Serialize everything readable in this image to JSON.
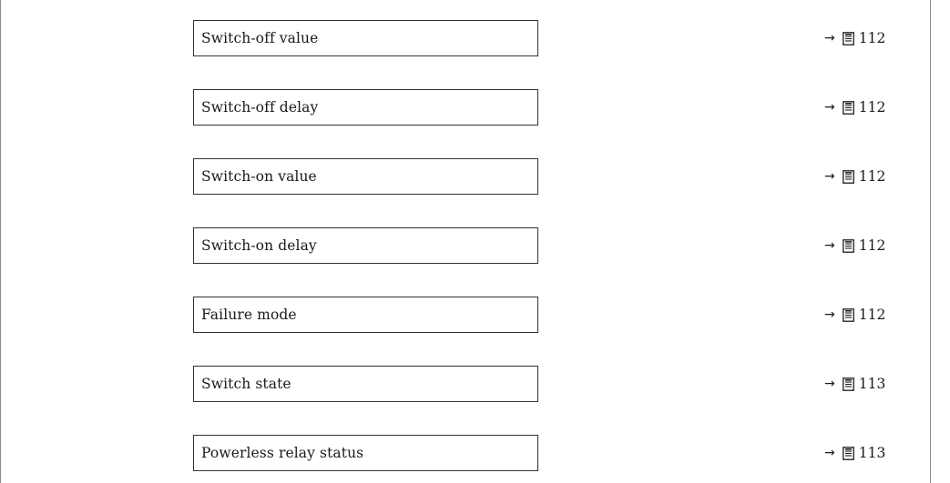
{
  "rows": [
    {
      "label": "Switch-off value",
      "arrow": "→",
      "page": "112"
    },
    {
      "label": "Switch-off delay",
      "arrow": "→",
      "page": "112"
    },
    {
      "label": "Switch-on value",
      "arrow": "→",
      "page": "112"
    },
    {
      "label": "Switch-on delay",
      "arrow": "→",
      "page": "112"
    },
    {
      "label": "Failure mode",
      "arrow": "→",
      "page": "112"
    },
    {
      "label": "Switch state",
      "arrow": "→",
      "page": "113"
    },
    {
      "label": "Powerless relay status",
      "arrow": "→",
      "page": "113"
    }
  ],
  "icons": {
    "page_reference": "page-reference-icon"
  }
}
